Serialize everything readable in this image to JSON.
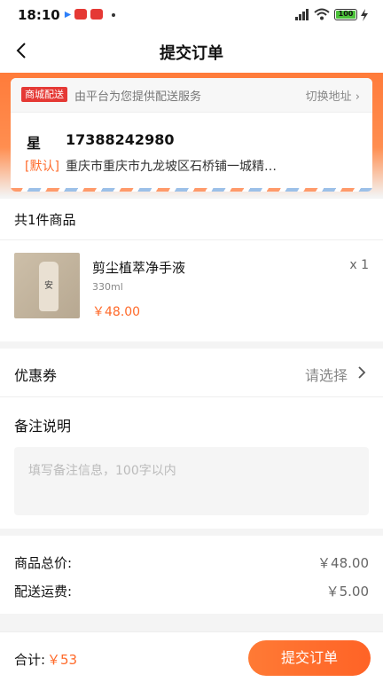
{
  "status_bar": {
    "time": "18:10",
    "battery": "100"
  },
  "header": {
    "title": "提交订单"
  },
  "address": {
    "tag": "商城配送",
    "tag_desc": "由平台为您提供配送服务",
    "switch_label": "切换地址",
    "name": "星",
    "phone": "17388242980",
    "default_tag": "[默认]",
    "address_line": "重庆市重庆市九龙坡区石桥铺一城精…"
  },
  "items": {
    "header": "共1件商品",
    "list": [
      {
        "name": "剪尘植萃净手液",
        "spec": "330ml",
        "price": "￥48.00",
        "qty": "x 1",
        "image_icon": "bottle-icon"
      }
    ]
  },
  "coupon": {
    "label": "优惠券",
    "value": "请选择"
  },
  "notes": {
    "label": "备注说明",
    "placeholder": "填写备注信息，100字以内"
  },
  "summary": {
    "goods_label": "商品总价:",
    "goods_value": "￥48.00",
    "shipping_label": "配送运费:",
    "shipping_value": "￥5.00"
  },
  "footer": {
    "total_label": "合计:",
    "total_value": "￥53",
    "submit_label": "提交订单"
  },
  "colors": {
    "accent": "#ff6a2a",
    "tag": "#e53935"
  }
}
